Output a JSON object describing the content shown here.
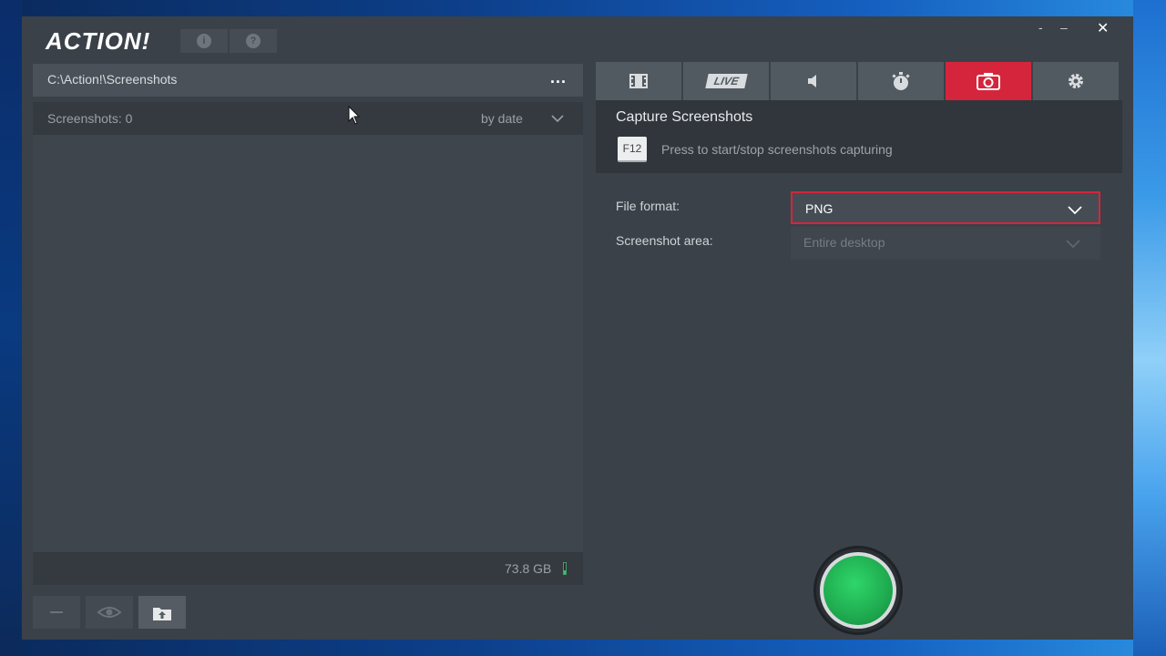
{
  "app": {
    "logo_text": "ACTION!",
    "info_icon": "info-icon",
    "help_icon": "help-icon",
    "window_controls": {
      "minimize_alt": "-",
      "minimize": "–",
      "close": "✕"
    }
  },
  "left_panel": {
    "path": "C:\\Action!\\Screenshots",
    "more_label": "...",
    "list": {
      "count_label": "Screenshots: 0",
      "sort_label": "by date",
      "items": []
    },
    "disk_free": "73.8 GB",
    "disk_fill_percent": 35
  },
  "bottom_bar": {
    "buttons": [
      {
        "name": "delete",
        "icon": "minus-icon"
      },
      {
        "name": "preview",
        "icon": "eye-icon"
      },
      {
        "name": "upload",
        "icon": "upload-folder-icon"
      }
    ]
  },
  "tabs": [
    {
      "name": "video",
      "icon": "film-icon"
    },
    {
      "name": "live",
      "label": "LIVE"
    },
    {
      "name": "audio",
      "icon": "speaker-icon"
    },
    {
      "name": "timer",
      "icon": "stopwatch-icon"
    },
    {
      "name": "screenshots",
      "icon": "camera-icon",
      "active": true
    },
    {
      "name": "settings",
      "icon": "gear-icon"
    }
  ],
  "capture": {
    "title": "Capture Screenshots",
    "hotkey": "F12",
    "hint": "Press to start/stop screenshots capturing"
  },
  "settings": {
    "file_format_label": "File format:",
    "file_format_value": "PNG",
    "screenshot_area_label": "Screenshot area:",
    "screenshot_area_value": "Entire desktop"
  },
  "colors": {
    "accent": "#d5253c",
    "record": "#1faa4f",
    "window_bg": "#3a4148"
  }
}
